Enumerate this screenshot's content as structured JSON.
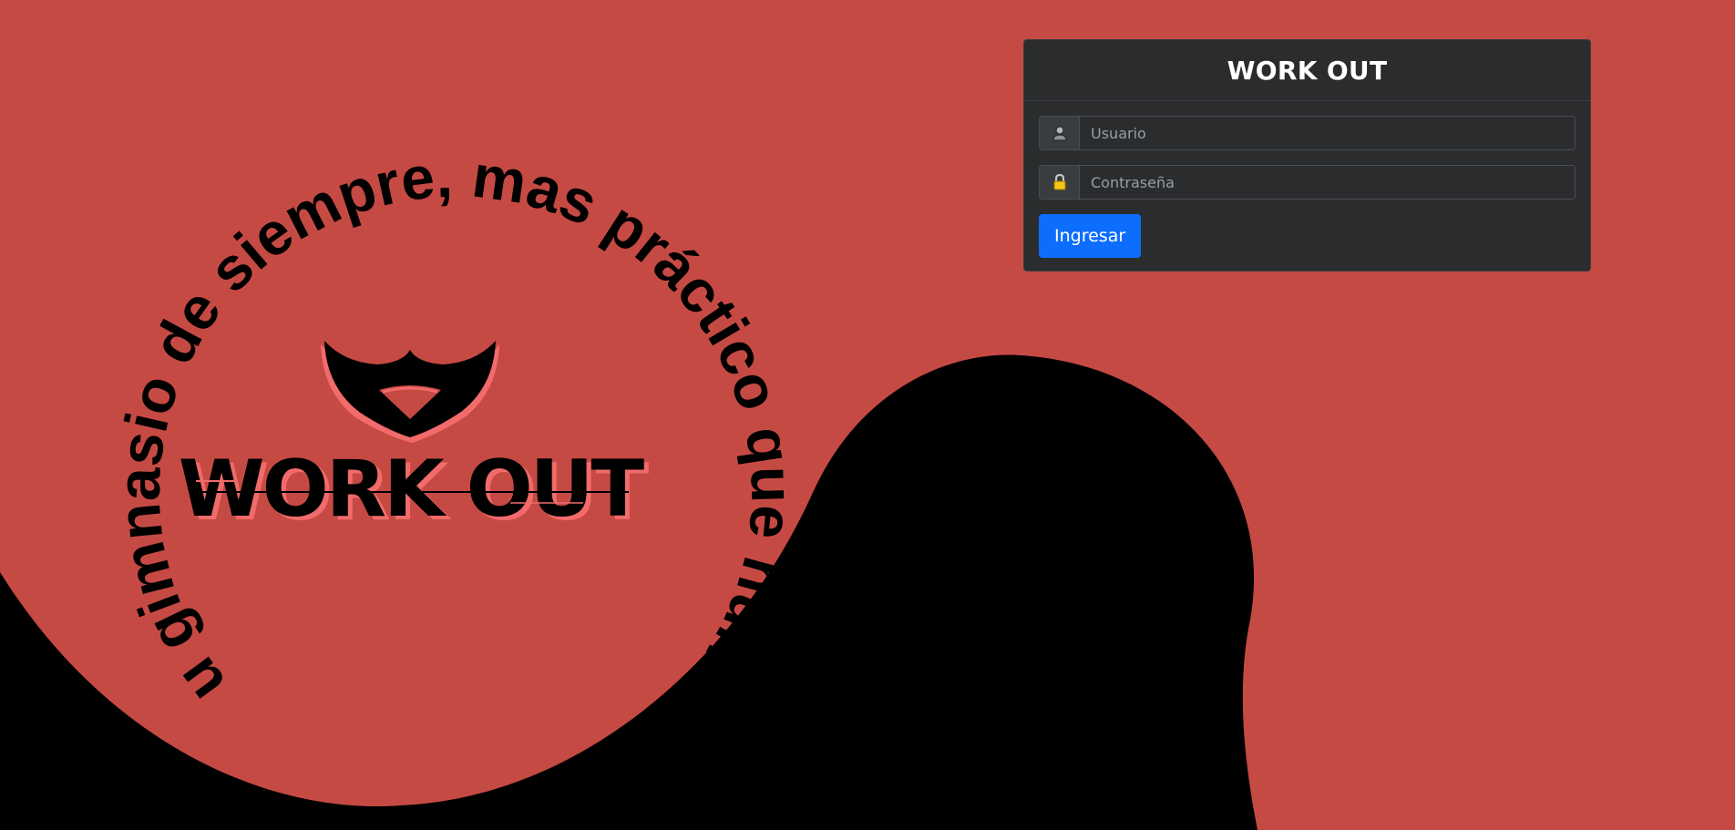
{
  "background": {
    "primary_color": "#c64a44",
    "shape_color": "#000000"
  },
  "hero": {
    "circle_text": "Tu gimnasio de siempre, mas  práctico que  nunca",
    "brand_name": "WORK OUT",
    "logo_icon": "mustache-icon",
    "logo_accent_color": "#f26b6b"
  },
  "login": {
    "title": "WORK OUT",
    "username": {
      "icon": "user-icon",
      "placeholder": "Usuario",
      "value": ""
    },
    "password": {
      "icon": "lock-icon",
      "placeholder": "Contraseña",
      "value": ""
    },
    "submit_label": "Ingresar",
    "accent_color": "#0d6efd"
  }
}
